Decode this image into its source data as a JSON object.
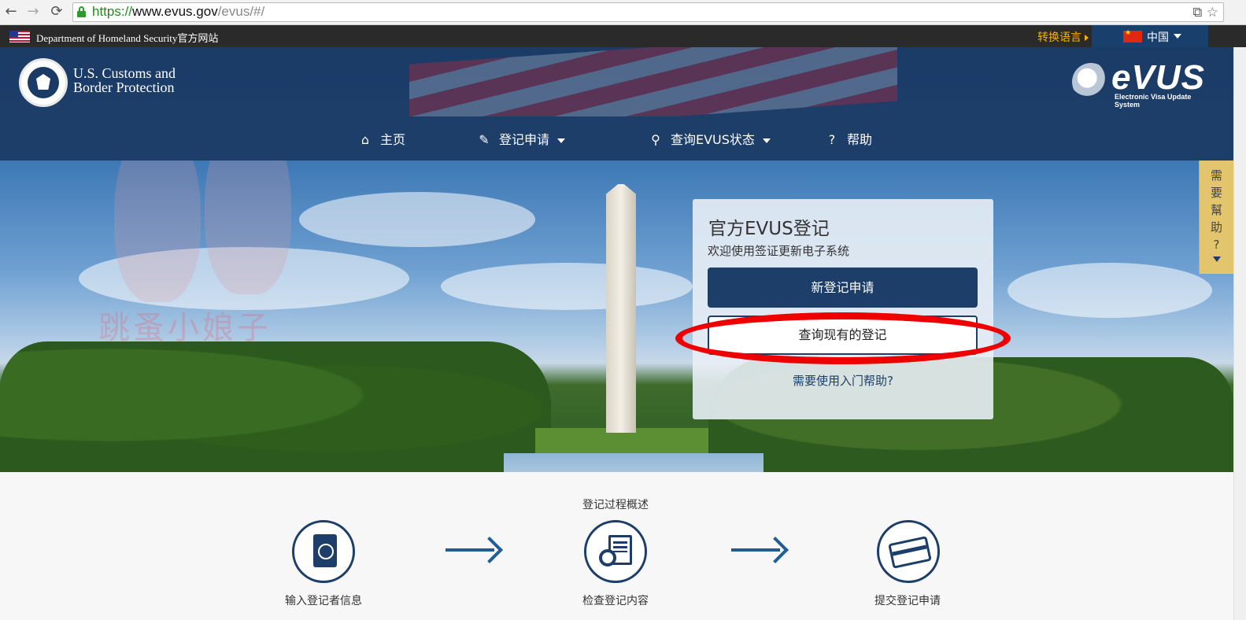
{
  "browser": {
    "url_scheme": "https://",
    "url_host": "www.evus.gov",
    "url_path": "/evus/#/",
    "back_icon": "←",
    "forward_icon": "→",
    "reload_icon": "⟳",
    "bookmark_icon": "☆",
    "translate_icon": "⧉"
  },
  "gov_banner": {
    "text": "Department of Homeland Security官方网站",
    "switch_language": "转换语言",
    "language": "中国"
  },
  "header": {
    "agency_line1": "U.S. Customs and",
    "agency_line2": "Border Protection",
    "evus_logo": "eVUS",
    "evus_tagline": "Electronic Visa Update System"
  },
  "nav": {
    "items": [
      {
        "label": "主页",
        "icon": "home-icon",
        "glyph": "⌂"
      },
      {
        "label": "登记申请",
        "icon": "edit-icon",
        "glyph": "✎"
      },
      {
        "label": "查询EVUS状态",
        "icon": "search-icon",
        "glyph": "⚲"
      },
      {
        "label": "帮助",
        "icon": "help-icon",
        "glyph": "?"
      }
    ]
  },
  "help_tab": {
    "chars": [
      "需",
      "要",
      "幫",
      "助",
      "?"
    ]
  },
  "card": {
    "title": "官方EVUS登记",
    "subtitle": "欢迎使用签证更新电子系统",
    "primary_button": "新登记申请",
    "secondary_button": "查询现有的登记",
    "help_link": "需要使用入门帮助?"
  },
  "watermark": "跳蚤小娘子",
  "process": {
    "title": "登记过程概述",
    "steps": [
      {
        "label": "输入登记者信息",
        "icon": "passport-icon"
      },
      {
        "label": "检查登记内容",
        "icon": "review-document-icon"
      },
      {
        "label": "提交登记申请",
        "icon": "credit-card-icon"
      }
    ]
  },
  "colors": {
    "navy": "#1c3e69",
    "highlight": "#ee0000",
    "help_tab": "#e3c56d",
    "gov_bar": "#2a2a2a"
  }
}
